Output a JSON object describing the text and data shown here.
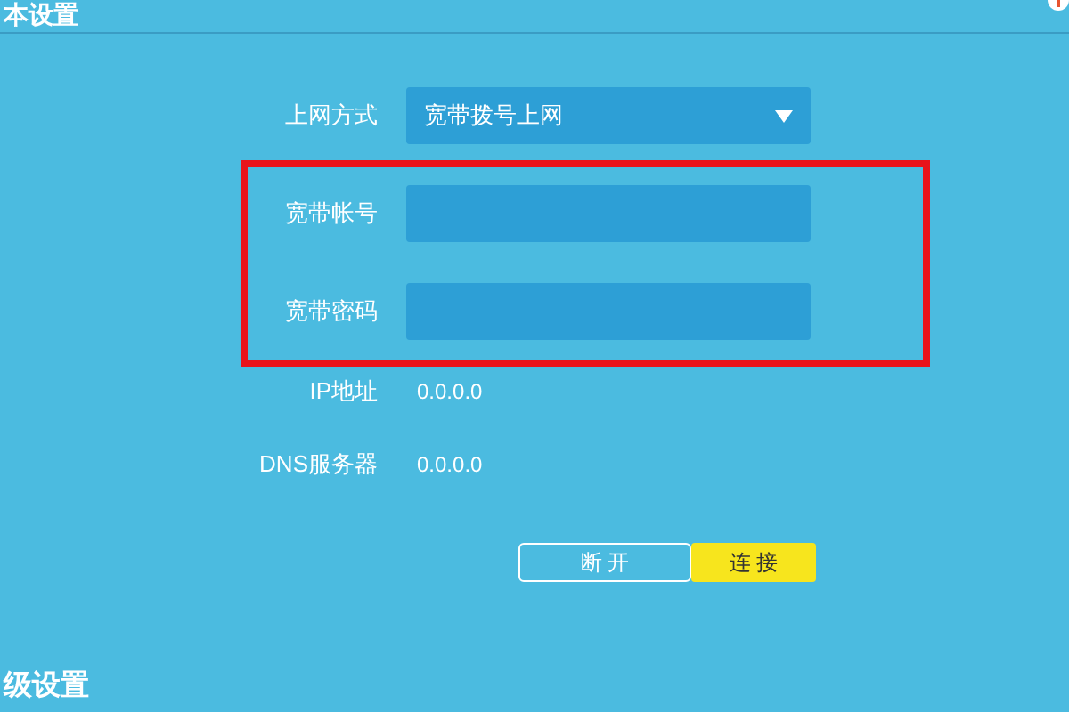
{
  "top_section": {
    "title": "本设置"
  },
  "form": {
    "rows": [
      {
        "kind": "select",
        "label": "上网方式",
        "value": "宽带拨号上网"
      },
      {
        "kind": "input",
        "label": "宽带帐号",
        "highlighted": true
      },
      {
        "kind": "input",
        "label": "宽带密码",
        "highlighted": true
      },
      {
        "kind": "text",
        "label": "IP地址",
        "value": "0.0.0.0"
      },
      {
        "kind": "text",
        "label": "DNS服务器",
        "value": "0.0.0.0"
      }
    ],
    "buttons": [
      {
        "kind": "outline",
        "label": "断 开"
      },
      {
        "kind": "primary",
        "label": "连 接"
      }
    ]
  },
  "bottom_section": {
    "title": "级设置"
  }
}
